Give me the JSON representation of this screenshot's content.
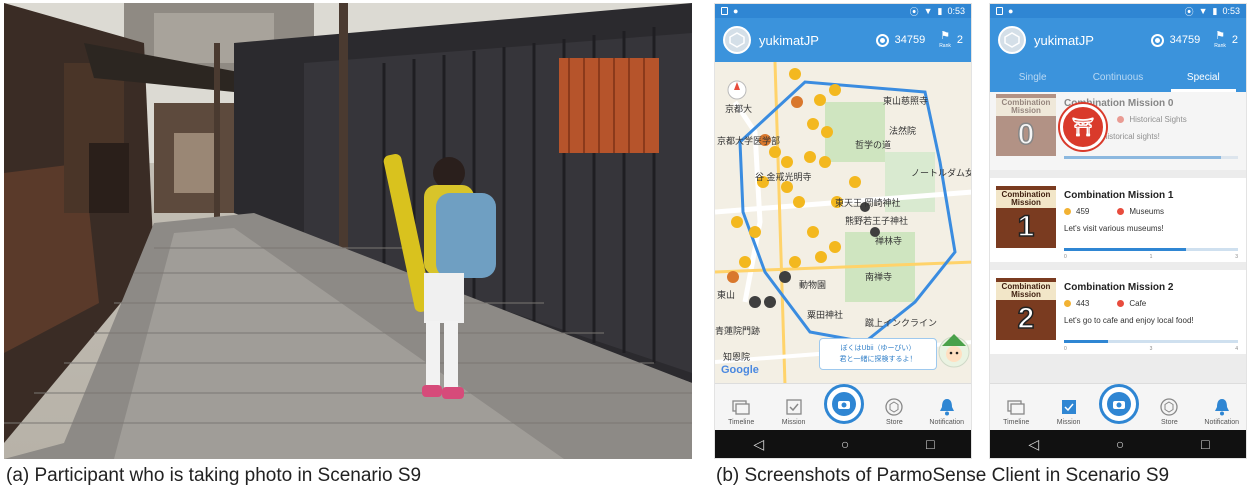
{
  "captions": {
    "a": "(a)  Participant who is taking photo in Scenario S9",
    "b": "(b) Screenshots of ParmoSense Client in Scenario S9"
  },
  "phone_common": {
    "status_time": "0:53",
    "username": "yukimatJP",
    "points": "34759",
    "points_unit": "pp",
    "rank": "2",
    "rank_label": "Rank"
  },
  "phone_map": {
    "labels": [
      "京都大",
      "京都大学医学部",
      "谷 金戒光明寺",
      "哲学の道",
      "東天王 岡崎神社",
      "熊野若王子神社",
      "禅林寺",
      "南禅寺",
      "粟田神社",
      "蹴上インクライン",
      "青蓮院門跡",
      "知恩院",
      "東山",
      "動物園",
      "ノートルダム女学院中学",
      "東山慈照寺",
      "法然院"
    ],
    "bubble_line1": "ぼくはUbii（ゆーびい）",
    "bubble_line2": "君と一緒に探検するよ！",
    "google": "Google"
  },
  "nav": {
    "timeline": "Timeline",
    "mission": "Mission",
    "store": "Store",
    "notification": "Notification"
  },
  "tabs": [
    "Single",
    "Continuous",
    "Special"
  ],
  "missions": [
    {
      "thumb_title": "Combination Mission",
      "thumb_num": "0",
      "title": "Combination Mission 0",
      "points": "383",
      "category": "Historical Sights",
      "desc": "Let's learn historical sights!",
      "progress": 0.9,
      "ticks": [
        "0",
        "",
        ""
      ],
      "stamp": "⛩"
    },
    {
      "thumb_title": "Combination Mission",
      "thumb_num": "1",
      "title": "Combination Mission 1",
      "points": "459",
      "category": "Museums",
      "desc": "Let's visit various museums!",
      "progress": 0.7,
      "ticks": [
        "0",
        "1",
        "3"
      ]
    },
    {
      "thumb_title": "Combination Mission",
      "thumb_num": "2",
      "title": "Combination Mission 2",
      "points": "443",
      "category": "Cafe",
      "desc": "Let's go to cafe and enjoy local food!",
      "progress": 0.25,
      "ticks": [
        "0",
        "3",
        "4"
      ]
    }
  ],
  "colors": {
    "primary": "#3b93dc",
    "statusbar": "#2f86d3",
    "points_dot": "#f2b233",
    "category_dot": "#e84c3d",
    "stamp": "#d93a2b"
  }
}
